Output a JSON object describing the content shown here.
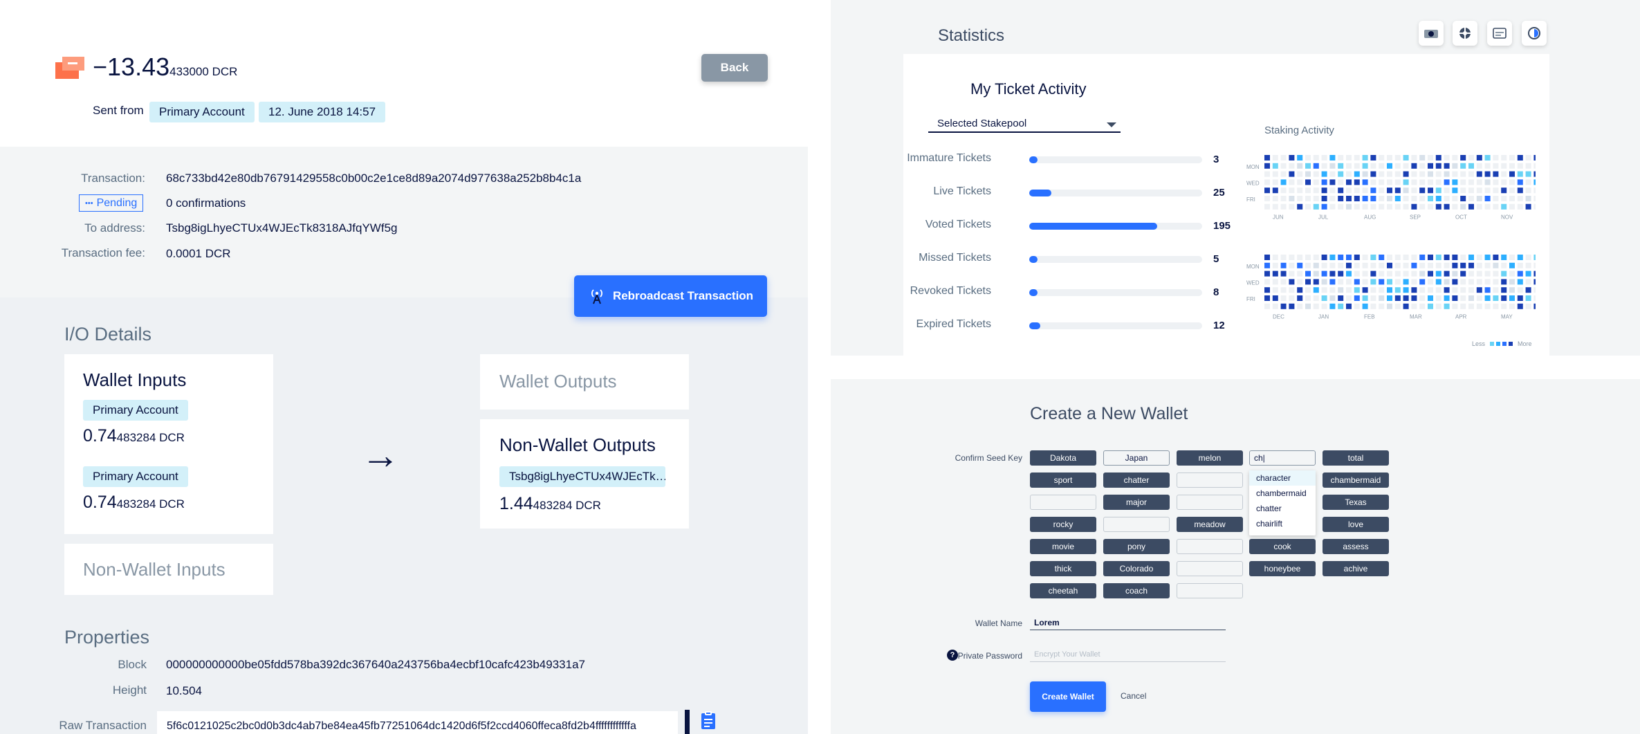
{
  "transaction": {
    "amount_main": "−13.43",
    "amount_small": "433000 DCR",
    "sent_from_label": "Sent from",
    "account": "Primary Account",
    "date": "12. June 2018 14:57",
    "back_label": "Back",
    "fields": {
      "transaction_label": "Transaction:",
      "transaction_hash": "68c733bd42e80db76791429558c0b00c2e1ce8d89a2074d977638a252b8b4c1a",
      "status": "Pending",
      "confirmations": "0 confirmations",
      "to_address_label": "To address:",
      "to_address": "Tsbg8igLhyeCTUx4WJEcTk8318AJfqYWf5g",
      "fee_label": "Transaction fee:",
      "fee": "0.0001 DCR"
    },
    "rebroadcast_label": "Rebroadcast Transaction"
  },
  "io": {
    "title": "I/O Details",
    "wallet_inputs_title": "Wallet Inputs",
    "inputs": [
      {
        "account": "Primary Account",
        "amount_main": "0.74",
        "amount_small": "483284 DCR"
      },
      {
        "account": "Primary Account",
        "amount_main": "0.74",
        "amount_small": "483284 DCR"
      }
    ],
    "non_wallet_inputs_title": "Non-Wallet Inputs",
    "wallet_outputs_title": "Wallet Outputs",
    "non_wallet_outputs_title": "Non-Wallet Outputs",
    "output_address": "Tsbg8igLhyeCTUx4WJEcTk…",
    "output_amount_main": "1.44",
    "output_amount_small": "483284 DCR",
    "arrow": "→"
  },
  "properties": {
    "title": "Properties",
    "block_label": "Block",
    "block": "000000000000be05fdd578ba392dc367640a243756ba4ecbf10cafc423b49331a7",
    "height_label": "Height",
    "height": "10.504",
    "raw_label": "Raw Transaction",
    "raw": "5f6c0121025c2bc0d0b3dc4ab7be84ea45fb77251064dc1420d6f5f2ccd4060ffeca8fd2b4ffffffffffffa"
  },
  "statistics": {
    "title": "Statistics",
    "card_title": "My Ticket Activity",
    "select_label": "Selected Stakepool",
    "staking_title": "Staking Activity",
    "tickets": [
      {
        "label": "Immature Tickets",
        "value": "3",
        "fraction": 0.015
      },
      {
        "label": "Live Tickets",
        "value": "25",
        "fraction": 0.128
      },
      {
        "label": "Voted Tickets",
        "value": "195",
        "fraction": 0.74
      },
      {
        "label": "Missed Tickets",
        "value": "5",
        "fraction": 0.03
      },
      {
        "label": "Revoked Tickets",
        "value": "8",
        "fraction": 0.041
      },
      {
        "label": "Expired Tickets",
        "value": "12",
        "fraction": 0.062
      }
    ],
    "heat_days": [
      "MON",
      "WED",
      "FRI"
    ],
    "heat_months_1": [
      "JUN",
      "JUL",
      "AUG",
      "SEP",
      "OCT",
      "NOV"
    ],
    "heat_months_2": [
      "DEC",
      "JAN",
      "FEB",
      "MAR",
      "APR",
      "MAY"
    ],
    "legend_less": "Less",
    "legend_more": "More",
    "colors": {
      "accent": "#2970ff",
      "light": "#d8e1ea",
      "l1": "#69d3f5",
      "l2": "#2ed6a1",
      "dark": "#091440"
    }
  },
  "create_wallet": {
    "title": "Create a New Wallet",
    "confirm_label": "Confirm Seed Key",
    "seed_rows": [
      [
        "Dakota",
        "Japan",
        "melon",
        "ch|",
        "total"
      ],
      [
        "sport",
        "chatter",
        "",
        "",
        "chambermaid"
      ],
      [
        "",
        "major",
        "",
        "",
        "Texas"
      ],
      [
        "rocky",
        "",
        "meadow",
        "",
        "love"
      ],
      [
        "movie",
        "pony",
        "",
        "cook",
        "assess"
      ],
      [
        "thick",
        "Colorado",
        "",
        "honeybee",
        "achive"
      ],
      [
        "cheetah",
        "coach",
        "",
        null,
        null
      ]
    ],
    "suggestions": [
      "character",
      "chambermaid",
      "chatter",
      "chairlift"
    ],
    "wallet_name_label": "Wallet Name",
    "wallet_name_value": "Lorem",
    "private_password_label": "Private Password",
    "password_placeholder": "Encrypt Your Wallet",
    "create_label": "Create Wallet",
    "cancel_label": "Cancel"
  }
}
